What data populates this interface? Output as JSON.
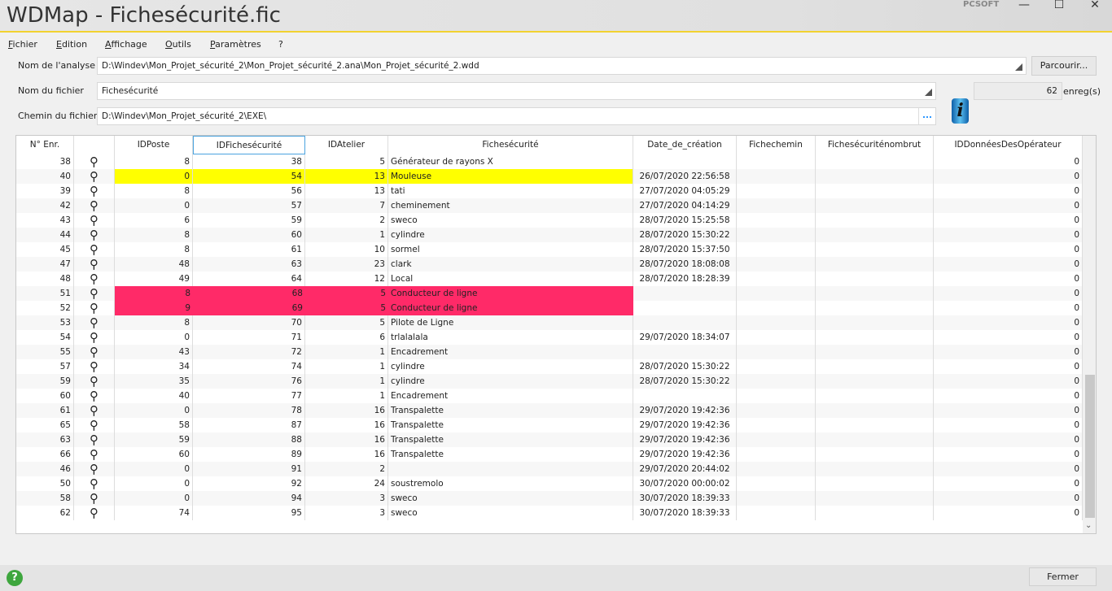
{
  "window": {
    "title": "WDMap - Fichesécurité.fic",
    "brand": "PCSOFT",
    "minimize": "—",
    "maximize": "☐",
    "close": "✕"
  },
  "menu": [
    "Fichier",
    "Edition",
    "Affichage",
    "Outils",
    "Paramètres",
    "?"
  ],
  "form": {
    "analyse_label": "Nom de l'analyse",
    "analyse_value": "D:\\Windev\\Mon_Projet_sécurité_2\\Mon_Projet_sécurité_2.ana\\Mon_Projet_sécurité_2.wdd",
    "browse_label": "Parcourir...",
    "fichier_label": "Nom du fichier",
    "fichier_value": "Fichesécurité",
    "chemin_label": "Chemin du fichier",
    "chemin_value": "D:\\Windev\\Mon_Projet_sécurité_2\\EXE\\",
    "ellipsis": "...",
    "count": "62",
    "count_unit": "enreg(s)"
  },
  "colors": {
    "highlight_yellow": "#ffff00",
    "highlight_red": "#ff2a68",
    "accent": "#4aa3df"
  },
  "table": {
    "columns": [
      "N° Enr.",
      "",
      "IDPoste",
      "IDFichesécurité",
      "IDAtelier",
      "Fichesécurité",
      "Date_de_création",
      "Fichechemin",
      "Fichesécuriténombrut",
      "IDDonnéesDesOpérateur"
    ],
    "rows": [
      {
        "enr": "38",
        "poste": "8",
        "idf": "38",
        "atelier": "5",
        "fiche": "Générateur de rayons X",
        "date": "",
        "op": "0",
        "hl": ""
      },
      {
        "enr": "40",
        "poste": "0",
        "idf": "54",
        "atelier": "13",
        "fiche": "Mouleuse",
        "date": "26/07/2020 22:56:58",
        "op": "0",
        "hl": "yellow"
      },
      {
        "enr": "39",
        "poste": "8",
        "idf": "56",
        "atelier": "13",
        "fiche": "tati",
        "date": "27/07/2020 04:05:29",
        "op": "0",
        "hl": ""
      },
      {
        "enr": "42",
        "poste": "0",
        "idf": "57",
        "atelier": "7",
        "fiche": "cheminement",
        "date": "27/07/2020 04:14:29",
        "op": "0",
        "hl": ""
      },
      {
        "enr": "43",
        "poste": "6",
        "idf": "59",
        "atelier": "2",
        "fiche": "sweco",
        "date": "28/07/2020 15:25:58",
        "op": "0",
        "hl": ""
      },
      {
        "enr": "44",
        "poste": "8",
        "idf": "60",
        "atelier": "1",
        "fiche": "cylindre",
        "date": "28/07/2020 15:30:22",
        "op": "0",
        "hl": ""
      },
      {
        "enr": "45",
        "poste": "8",
        "idf": "61",
        "atelier": "10",
        "fiche": "sormel",
        "date": "28/07/2020 15:37:50",
        "op": "0",
        "hl": ""
      },
      {
        "enr": "47",
        "poste": "48",
        "idf": "63",
        "atelier": "23",
        "fiche": "clark",
        "date": "28/07/2020 18:08:08",
        "op": "0",
        "hl": ""
      },
      {
        "enr": "48",
        "poste": "49",
        "idf": "64",
        "atelier": "12",
        "fiche": "Local",
        "date": "28/07/2020 18:28:39",
        "op": "0",
        "hl": ""
      },
      {
        "enr": "51",
        "poste": "8",
        "idf": "68",
        "atelier": "5",
        "fiche": "Conducteur de ligne",
        "date": "",
        "op": "0",
        "hl": "red"
      },
      {
        "enr": "52",
        "poste": "9",
        "idf": "69",
        "atelier": "5",
        "fiche": "Conducteur de ligne",
        "date": "",
        "op": "0",
        "hl": "red"
      },
      {
        "enr": "53",
        "poste": "8",
        "idf": "70",
        "atelier": "5",
        "fiche": "Pilote de Ligne",
        "date": "",
        "op": "0",
        "hl": ""
      },
      {
        "enr": "54",
        "poste": "0",
        "idf": "71",
        "atelier": "6",
        "fiche": "trlalalala",
        "date": "29/07/2020 18:34:07",
        "op": "0",
        "hl": ""
      },
      {
        "enr": "55",
        "poste": "43",
        "idf": "72",
        "atelier": "1",
        "fiche": "Encadrement",
        "date": "",
        "op": "0",
        "hl": ""
      },
      {
        "enr": "57",
        "poste": "34",
        "idf": "74",
        "atelier": "1",
        "fiche": "cylindre",
        "date": "28/07/2020 15:30:22",
        "op": "0",
        "hl": ""
      },
      {
        "enr": "59",
        "poste": "35",
        "idf": "76",
        "atelier": "1",
        "fiche": "cylindre",
        "date": "28/07/2020 15:30:22",
        "op": "0",
        "hl": ""
      },
      {
        "enr": "60",
        "poste": "40",
        "idf": "77",
        "atelier": "1",
        "fiche": "Encadrement",
        "date": "",
        "op": "0",
        "hl": ""
      },
      {
        "enr": "61",
        "poste": "0",
        "idf": "78",
        "atelier": "16",
        "fiche": "Transpalette",
        "date": "29/07/2020 19:42:36",
        "op": "0",
        "hl": ""
      },
      {
        "enr": "65",
        "poste": "58",
        "idf": "87",
        "atelier": "16",
        "fiche": "Transpalette",
        "date": "29/07/2020 19:42:36",
        "op": "0",
        "hl": ""
      },
      {
        "enr": "63",
        "poste": "59",
        "idf": "88",
        "atelier": "16",
        "fiche": "Transpalette",
        "date": "29/07/2020 19:42:36",
        "op": "0",
        "hl": ""
      },
      {
        "enr": "66",
        "poste": "60",
        "idf": "89",
        "atelier": "16",
        "fiche": "Transpalette",
        "date": "29/07/2020 19:42:36",
        "op": "0",
        "hl": ""
      },
      {
        "enr": "46",
        "poste": "0",
        "idf": "91",
        "atelier": "2",
        "fiche": "",
        "date": "29/07/2020 20:44:02",
        "op": "0",
        "hl": ""
      },
      {
        "enr": "50",
        "poste": "0",
        "idf": "92",
        "atelier": "24",
        "fiche": "soustremolo",
        "date": "30/07/2020 00:00:02",
        "op": "0",
        "hl": ""
      },
      {
        "enr": "58",
        "poste": "0",
        "idf": "94",
        "atelier": "3",
        "fiche": "sweco",
        "date": "30/07/2020 18:39:33",
        "op": "0",
        "hl": ""
      },
      {
        "enr": "62",
        "poste": "74",
        "idf": "95",
        "atelier": "3",
        "fiche": "sweco",
        "date": "30/07/2020 18:39:33",
        "op": "0",
        "hl": ""
      }
    ]
  },
  "footer": {
    "help": "?",
    "close_label": "Fermer"
  }
}
